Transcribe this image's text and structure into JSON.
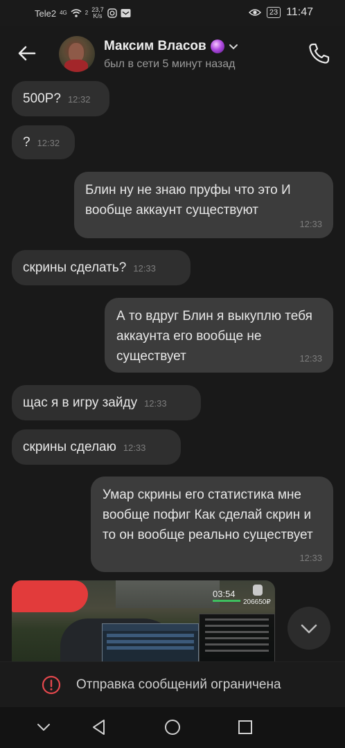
{
  "status_bar": {
    "carrier": "Tele2",
    "network": "4G",
    "signal_index": "2",
    "speed_value": "23,7",
    "speed_unit": "K/s",
    "battery": "23",
    "time": "11:47"
  },
  "header": {
    "contact_name": "Максим Власов",
    "last_seen": "был в сети 5 минут назад"
  },
  "messages": [
    {
      "direction": "incoming",
      "text": "500Р?",
      "time": "12:32"
    },
    {
      "direction": "incoming",
      "text": "?",
      "time": "12:32"
    },
    {
      "direction": "outgoing",
      "text": "Блин ну не знаю пруфы что это И вообще аккаунт существуют",
      "time": "12:33"
    },
    {
      "direction": "incoming",
      "text": "скрины сделать?",
      "time": "12:33"
    },
    {
      "direction": "outgoing",
      "text": "А то вдруг Блин я выкуплю тебя аккаунта его вообще не существует",
      "time": "12:33"
    },
    {
      "direction": "incoming",
      "text": "щас я в игру зайду",
      "time": "12:33"
    },
    {
      "direction": "incoming",
      "text": "скрины сделаю",
      "time": "12:33"
    },
    {
      "direction": "outgoing",
      "text": "Умар скрины его статистика мне вообще пофиг Как сделай скрин и то он вообще реально существует",
      "time": "12:33"
    }
  ],
  "photo": {
    "game_time": "03:54",
    "game_money": "206650₽"
  },
  "restricted_notice": "Отправка сообщений ограничена",
  "icons": {
    "back": "arrow-left-icon",
    "phone": "phone-icon",
    "verified": "purple-orb-icon",
    "scroll": "chevron-down-icon",
    "warning": "warning-circle-icon"
  },
  "colors": {
    "background": "#191919",
    "incoming_bubble": "#2f2f2f",
    "outgoing_bubble": "#3c3c3c",
    "warning": "#e5484d"
  }
}
